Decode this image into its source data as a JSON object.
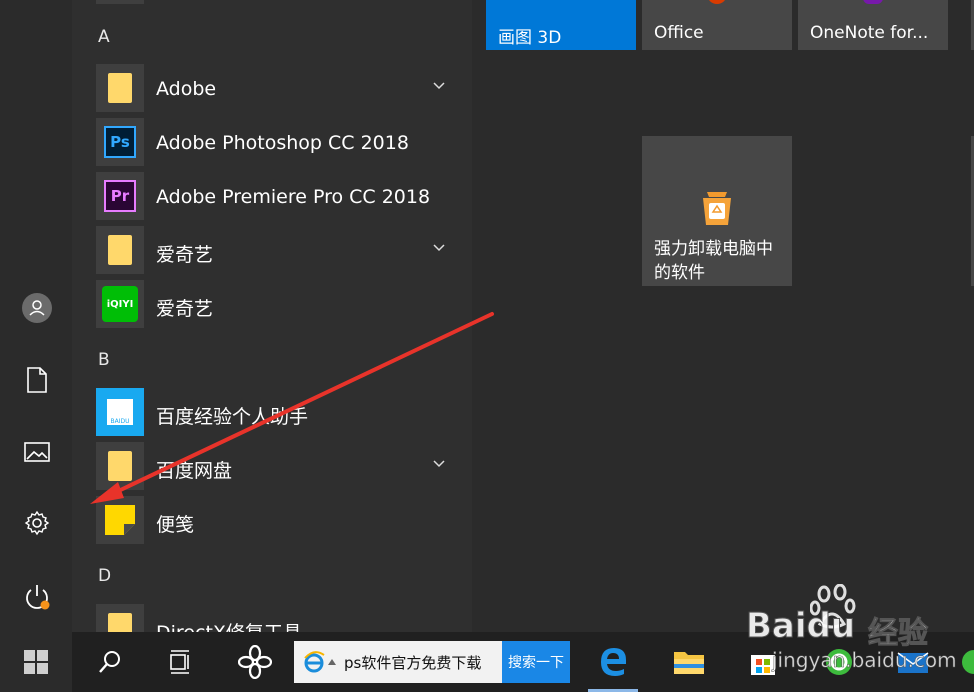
{
  "sections": {
    "a": "A",
    "b": "B",
    "d": "D"
  },
  "apps": {
    "adobe": "Adobe",
    "photoshop": "Adobe Photoshop CC 2018",
    "premiere": "Adobe Premiere Pro CC 2018",
    "iqiyi_folder": "爱奇艺",
    "iqiyi": "爱奇艺",
    "baidu_jingyan": "百度经验个人助手",
    "baidu_pan": "百度网盘",
    "sticky_notes": "便笺",
    "directx": "DirectX修复工具"
  },
  "icons": {
    "ps_text": "Ps",
    "pr_text": "Pr",
    "iqiyi_text": "iQIYI",
    "baidu_text": "BAIDU"
  },
  "tiles": {
    "paint3d": "画图 3D",
    "office": "Office",
    "onenote": "OneNote for...",
    "uninstall_line1": "强力卸载电脑中",
    "uninstall_line2": "的软件"
  },
  "taskbar": {
    "search_value": "ps软件官方免费下载",
    "search_button": "搜索一下"
  },
  "watermark": {
    "brand": "Baidu",
    "brand_cn": "经验",
    "url": "jingyan.baidu.com"
  },
  "colors": {
    "accent": "#0078d7",
    "arrow": "#e8332a",
    "photoshop": "#31a8ff",
    "premiere": "#9999ff",
    "iqiyi": "#00be06",
    "sticky": "#ffd800"
  }
}
